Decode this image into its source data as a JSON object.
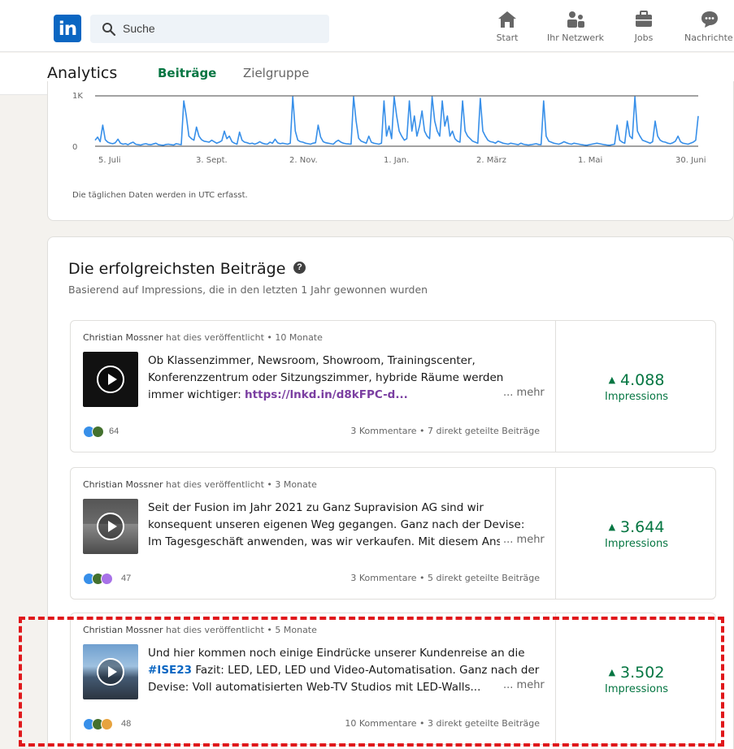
{
  "nav": {
    "logo": "in",
    "search_placeholder": "Suche",
    "items": [
      {
        "label": "Start",
        "icon": "home-icon"
      },
      {
        "label": "Ihr Netzwerk",
        "icon": "network-icon"
      },
      {
        "label": "Jobs",
        "icon": "briefcase-icon"
      },
      {
        "label": "Nachrichte",
        "icon": "messaging-icon"
      }
    ]
  },
  "analytics": {
    "title": "Analytics",
    "tabs": [
      {
        "label": "Beiträge",
        "active": true
      },
      {
        "label": "Zielgruppe",
        "active": false
      }
    ]
  },
  "chart_data": {
    "type": "line",
    "y_ticks": [
      "1K",
      "0"
    ],
    "x_ticks": [
      "5. Juli",
      "3. Sept.",
      "2. Nov.",
      "1. Jan.",
      "2. März",
      "1. Mai",
      "30. Juni"
    ],
    "ylim": [
      0,
      1000
    ],
    "color": "#378fe9",
    "values": [
      120,
      180,
      90,
      420,
      130,
      80,
      60,
      50,
      70,
      140,
      60,
      40,
      50,
      30,
      60,
      80,
      40,
      30,
      25,
      40,
      50,
      35,
      30,
      45,
      60,
      30,
      25,
      20,
      35,
      40,
      30,
      25,
      50,
      40,
      30,
      900,
      600,
      200,
      150,
      120,
      380,
      200,
      130,
      100,
      90,
      80,
      120,
      90,
      60,
      80,
      110,
      300,
      150,
      200,
      90,
      60,
      40,
      280,
      120,
      80,
      70,
      50,
      60,
      40,
      60,
      90,
      60,
      45,
      40,
      80,
      60,
      140,
      70,
      50,
      60,
      50,
      40,
      60,
      980,
      300,
      120,
      90,
      80,
      60,
      50,
      40,
      60,
      70,
      420,
      180,
      90,
      70,
      60,
      50,
      40,
      90,
      120,
      80,
      60,
      50,
      45,
      40,
      980,
      500,
      160,
      100,
      80,
      60,
      200,
      80,
      60,
      50,
      40,
      60,
      900,
      200,
      400,
      150,
      980,
      600,
      300,
      200,
      120,
      150,
      900,
      300,
      600,
      200,
      400,
      700,
      300,
      200,
      150,
      980,
      500,
      300,
      200,
      900,
      400,
      600,
      200,
      300,
      150,
      100,
      80,
      900,
      300,
      200,
      150,
      100,
      80,
      60,
      950,
      300,
      200,
      120,
      90,
      80,
      60,
      100,
      80,
      60,
      50,
      40,
      60,
      50,
      40,
      30,
      60,
      40,
      30,
      25,
      30,
      40,
      50,
      35,
      30,
      900,
      200,
      100,
      80,
      60,
      50,
      40,
      60,
      90,
      70,
      50,
      40,
      60,
      50,
      40,
      30,
      25,
      20,
      30,
      40,
      50,
      60,
      50,
      40,
      30,
      25,
      20,
      30,
      40,
      420,
      120,
      80,
      60,
      500,
      200,
      150,
      980,
      300,
      200,
      120,
      100,
      80,
      60,
      90,
      500,
      200,
      120,
      90,
      80,
      60,
      50,
      70,
      100,
      200,
      90,
      60,
      50,
      40,
      60,
      80,
      120,
      600
    ]
  },
  "chart_note": "Die täglichen Daten werden in UTC erfasst.",
  "top_posts": {
    "title": "Die erfolgreichsten Beiträge",
    "subtitle": "Basierend auf Impressions, die in den letzten 1 Jahr gewonnen wurden",
    "more_label": "... mehr",
    "impressions_label": "Impressions",
    "posts": [
      {
        "author": "Christian Mossner",
        "meta": " hat dies veröffentlicht • 10 Monate",
        "text": "Ob Klassenzimmer, Newsroom, Showroom, Trainingscenter, Konferenzzentrum oder Sitzungszimmer, hybride Räume werden immer wichtiger: ",
        "link": "https://lnkd.in/d8kFPC-d...",
        "reactions": "64",
        "stats": "3 Kommentare • 7 direkt geteilte Beiträge",
        "impressions": "4.088"
      },
      {
        "author": "Christian Mossner",
        "meta": " hat dies veröffentlicht • 3 Monate",
        "text": "Seit der Fusion im Jahr 2021 zu Ganz Supravision AG sind wir konsequent unseren eigenen Weg gegangen. Ganz nach der Devise: Im Tagesgeschäft anwenden, was wir verkaufen. Mit diesem Ansatz haben viele neu",
        "reactions": "47",
        "stats": "3 Kommentare • 5 direkt geteilte Beiträge",
        "impressions": "3.644"
      },
      {
        "author": "Christian Mossner",
        "meta": " hat dies veröffentlicht • 5 Monate",
        "text_before": "Und hier kommen noch einige Eindrücke unserer Kundenreise an die ",
        "hashtag": "#ISE23",
        "text_after": " Fazit: LED, LED, LED und Video-Automatisation. Ganz nach der Devise: Voll automatisierten Web-TV Studios mit LED-Walls...",
        "reactions": "48",
        "stats": "10 Kommentare • 3 direkt geteilte Beiträge",
        "impressions": "3.502"
      }
    ]
  }
}
